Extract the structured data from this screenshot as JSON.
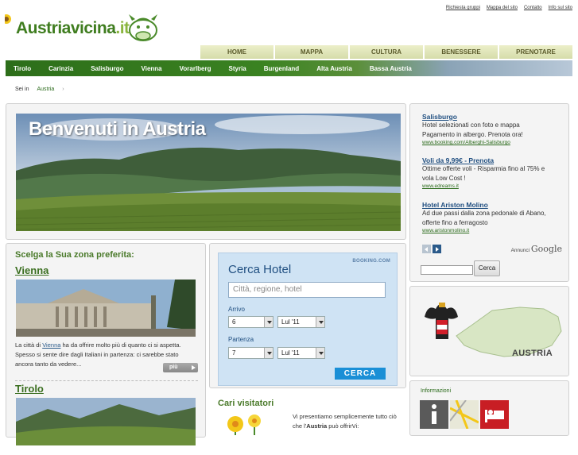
{
  "header": {
    "logo_main": "Austriavicina",
    "logo_suffix": ".it",
    "toplinks": [
      "Richiesta gruppi",
      "Mappa del sito",
      "Contatto",
      "Info sul sito"
    ]
  },
  "mainnav": [
    "HOME",
    "MAPPA",
    "CULTURA",
    "BENESSERE",
    "PRENOTARE"
  ],
  "regions": [
    "Tirolo",
    "Carinzia",
    "Salisburgo",
    "Vienna",
    "Vorarlberg",
    "Styria",
    "Burgenland",
    "Alta Austria",
    "Bassa Austria"
  ],
  "breadcrumb": {
    "label": "Sei in",
    "item": "Austria",
    "sep": "›"
  },
  "hero": {
    "title": "Benvenuti in Austria"
  },
  "zones": {
    "heading": "Scelga la Sua zona preferita:",
    "items": [
      {
        "title": "Vienna",
        "text_before": "La città di ",
        "link": "Vienna",
        "text_after": " ha da offrire molto più di quanto ci si aspetta. Spesso si sente dire dagli Italiani in partenza: ci sarebbe stato ancora tanto da vedere...",
        "more": "più"
      },
      {
        "title": "Tirolo"
      }
    ]
  },
  "booking": {
    "title": "Cerca Hotel",
    "brand": "BOOKING.COM",
    "placeholder": "Città, regione, hotel",
    "arrival_label": "Arrivo",
    "arrival_day": "6",
    "arrival_month": "Lul '11",
    "departure_label": "Partenza",
    "departure_day": "7",
    "departure_month": "Lul '11",
    "button": "CERCA"
  },
  "visitors": {
    "title": "Cari visitatori",
    "text_before": "Vi presentiamo semplicemente tutto ciò che l'",
    "bold": "Austria",
    "text_after": " può offrirVi:"
  },
  "ads": {
    "items": [
      {
        "title": "Salisburgo",
        "lines": [
          "Hotel selezionati con foto e mappa",
          "Pagamento in albergo. Prenota ora!"
        ],
        "url": "www.booking.com/Alberghi-Salisburgo"
      },
      {
        "title": "Voli da 9,99€ - Prenota",
        "lines": [
          "Ottime offerte voli - Risparmia fino al 75% e",
          "vola Low Cost !"
        ],
        "url": "www.edreams.it"
      },
      {
        "title": "Hotel Ariston Molino",
        "lines": [
          "Ad due passi dalla zona pedonale di Abano,",
          "offerte fino a ferragosto"
        ],
        "url": "www.aristonmolino.it"
      }
    ],
    "google_prefix": "Annunci",
    "google": "Google",
    "search_button": "Cerca"
  },
  "map": {
    "label": "AUSTRIA"
  },
  "info": {
    "title": "Informazioni"
  },
  "colors": {
    "green": "#3f7d1f",
    "nav_bg": "#ecefc9",
    "link_blue": "#1f4e80",
    "booking_blue": "#1a8fd6"
  }
}
